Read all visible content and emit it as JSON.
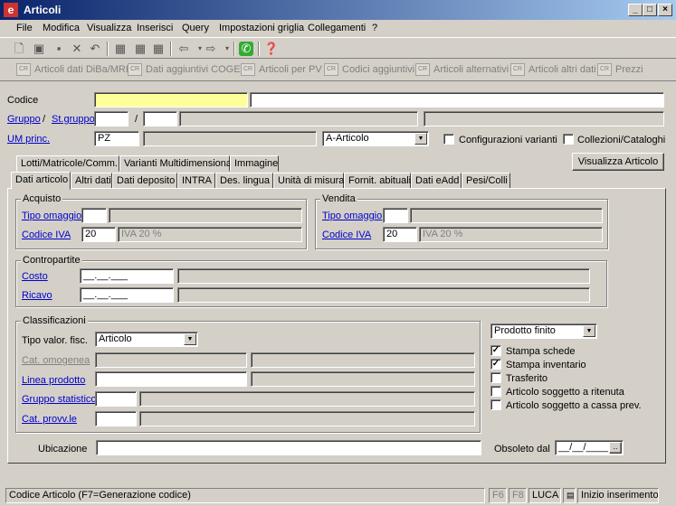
{
  "window": {
    "title": "Articoli",
    "logo": "e",
    "min": "_",
    "max": "□",
    "close": "×"
  },
  "menu": [
    "File",
    "Modifica",
    "Visualizza",
    "Inserisci",
    "Query",
    "Impostazioni griglia",
    "Collegamenti",
    "?"
  ],
  "toolbar_icons": [
    "new-doc-icon",
    "edit-doc-icon",
    "save-icon",
    "delete-icon",
    "undo-icon",
    "grid-icon",
    "grid-edit-icon",
    "grid-delete-icon",
    "back-icon",
    "forward-icon",
    "phone-icon",
    "help-icon"
  ],
  "toolbar2": [
    "Articoli dati DiBa/MRP",
    "Dati aggiuntivi COGES",
    "Articoli per PV",
    "Codici aggiuntivi",
    "Articoli alternativi",
    "Articoli altri dati",
    "Prezzi"
  ],
  "header": {
    "codice_label": "Codice",
    "gruppo_label": "Gruppo",
    "slash": "/",
    "stgruppo_label": "St.gruppo",
    "slash2": "/",
    "um_label": "UM princ.",
    "um_value": "PZ",
    "tipo_articolo": "A-Articolo",
    "config_varianti": "Configurazioni varianti",
    "collezioni": "Collezioni/Cataloghi"
  },
  "tabs_top": [
    "Lotti/Matricole/Comm.",
    "Varianti Multidimensionali",
    "Immagine"
  ],
  "visualizza_button": "Visualizza Articolo",
  "tabs": [
    "Dati articolo",
    "Altri dati",
    "Dati deposito",
    "INTRA",
    "Des. lingua",
    "Unità di misura",
    "Fornit. abituali",
    "Dati eAdd",
    "Pesi/Colli"
  ],
  "acquisto": {
    "title": "Acquisto",
    "tipo_omaggio": "Tipo omaggio",
    "codice_iva": "Codice IVA",
    "iva_code": "20",
    "iva_desc": "IVA 20 %"
  },
  "vendita": {
    "title": "Vendita",
    "tipo_omaggio": "Tipo omaggio",
    "codice_iva": "Codice IVA",
    "iva_code": "20",
    "iva_desc": "IVA 20 %"
  },
  "contropartite": {
    "title": "Contropartite",
    "costo": "Costo",
    "ricavo": "Ricavo",
    "mask": "__.__.___"
  },
  "classificazioni": {
    "title": "Classificazioni",
    "tipo_valor": "Tipo valor. fisc.",
    "tipo_valor_value": "Articolo",
    "cat_omogenea": "Cat. omogenea",
    "linea_prodotto": "Linea prodotto",
    "gruppo_statistico": "Gruppo statistico",
    "cat_provv": "Cat. provv.le"
  },
  "right_panel": {
    "tipo_prodotto": "Prodotto finito",
    "checks": [
      {
        "label": "Stampa schede",
        "checked": true
      },
      {
        "label": "Stampa inventario",
        "checked": true
      },
      {
        "label": "Trasferito",
        "checked": false
      },
      {
        "label": "Articolo soggetto a ritenuta",
        "checked": false
      },
      {
        "label": "Articolo soggetto a cassa prev.",
        "checked": false
      }
    ]
  },
  "ubicazione_label": "Ubicazione",
  "obsoleto_label": "Obsoleto dal",
  "obsoleto_mask": "__/__/____",
  "date_button": "..",
  "status": {
    "hint": "Codice Articolo  (F7=Generazione codice)",
    "f6": "F6",
    "f8": "F8",
    "user": "LUCA",
    "mode": "Inizio inserimento.."
  },
  "colors": {
    "title_start": "#0a246a",
    "title_end": "#a6caf0",
    "required_field": "#ffff99",
    "link": "#0000cc"
  }
}
